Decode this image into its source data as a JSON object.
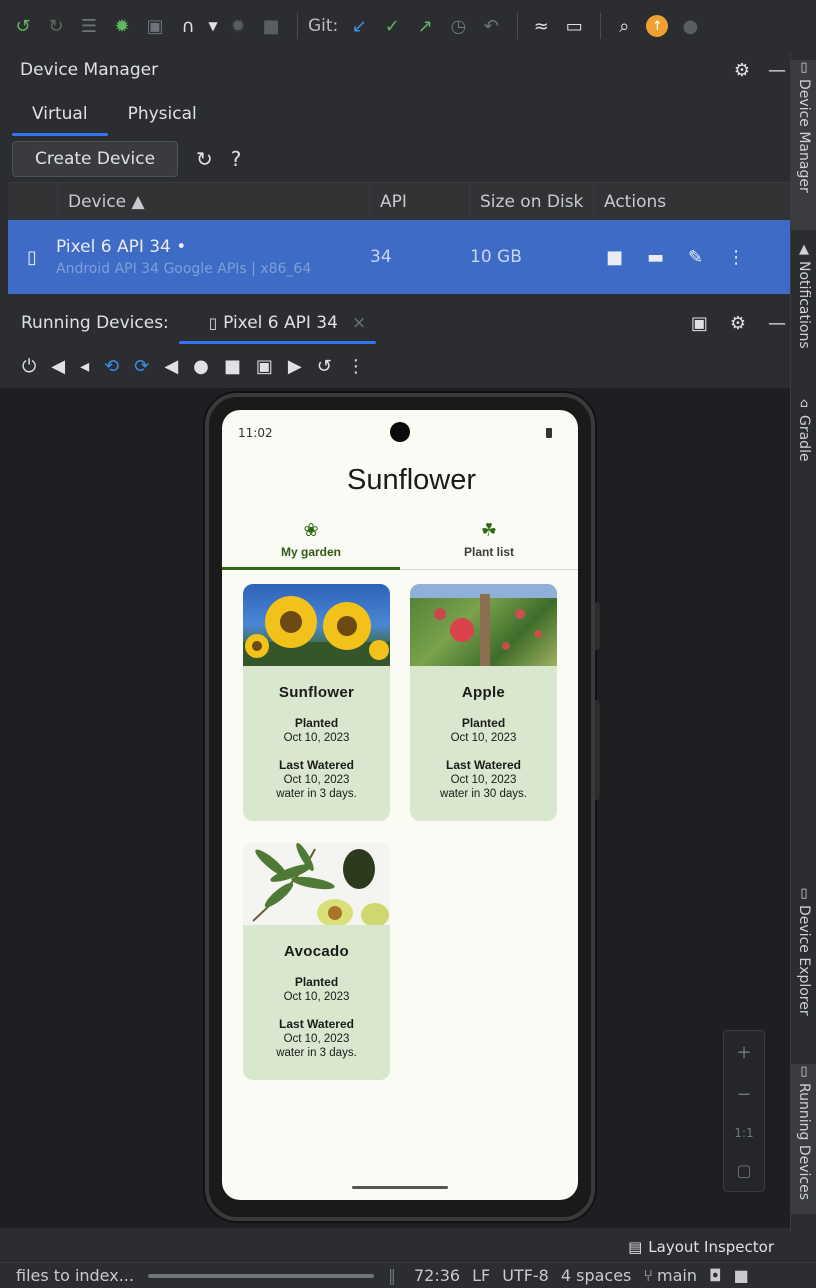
{
  "toolbar": {
    "git_label": "Git:",
    "icons": [
      "sync-icon",
      "rerun-icon",
      "list-icon",
      "debug-icon",
      "attach-icon",
      "profile-icon",
      "chevron-down-icon",
      "stop-disabled-icon",
      "stop-icon",
      "git-update-icon",
      "git-commit-icon",
      "git-push-icon",
      "history-icon",
      "rollback-icon",
      "ai-icon",
      "device-mirror-icon",
      "search-icon",
      "update-icon",
      "account-icon"
    ]
  },
  "device_manager": {
    "title": "Device Manager",
    "tabs": [
      "Virtual",
      "Physical"
    ],
    "active_tab": "Virtual",
    "create_button": "Create Device",
    "help_label": "?",
    "columns": {
      "device": "Device ▲",
      "api": "API",
      "size": "Size on Disk",
      "actions": "Actions"
    },
    "row": {
      "name": "Pixel 6 API 34 •",
      "subtitle": "Android API 34 Google APIs | x86_64",
      "api": "34",
      "size": "10 GB"
    }
  },
  "running_devices": {
    "label": "Running Devices:",
    "tab_label": "Pixel 6 API 34",
    "close_glyph": "×"
  },
  "phone": {
    "time": "11:02",
    "app_title": "Sunflower",
    "tabs": [
      {
        "label": "My garden",
        "active": true
      },
      {
        "label": "Plant list",
        "active": false
      }
    ],
    "cards": [
      {
        "name": "Sunflower",
        "planted_label": "Planted",
        "planted": "Oct 10, 2023",
        "watered_label": "Last Watered",
        "watered": "Oct 10, 2023",
        "next": "water in 3 days."
      },
      {
        "name": "Apple",
        "planted_label": "Planted",
        "planted": "Oct 10, 2023",
        "watered_label": "Last Watered",
        "watered": "Oct 10, 2023",
        "next": "water in 30 days."
      },
      {
        "name": "Avocado",
        "planted_label": "Planted",
        "planted": "Oct 10, 2023",
        "watered_label": "Last Watered",
        "watered": "Oct 10, 2023",
        "next": "water in 3 days."
      }
    ]
  },
  "zoom": {
    "plus": "+",
    "minus": "−",
    "one_to_one": "1:1"
  },
  "right_strip": {
    "device_manager": "Device Manager",
    "notifications": "Notifications",
    "gradle": "Gradle",
    "device_explorer": "Device Explorer",
    "running_devices": "Running Devices"
  },
  "layout_inspector": "Layout Inspector",
  "statusbar": {
    "indexing": "files to index...",
    "position": "72:36",
    "line_ending": "LF",
    "encoding": "UTF-8",
    "indent": "4 spaces",
    "branch": "main"
  },
  "colors": {
    "accent": "#3574f0",
    "selected_row": "#3e6bc6",
    "card_bg": "#d8e7cd",
    "garden_green": "#2e6b12",
    "update_badge": "#f0a030"
  }
}
